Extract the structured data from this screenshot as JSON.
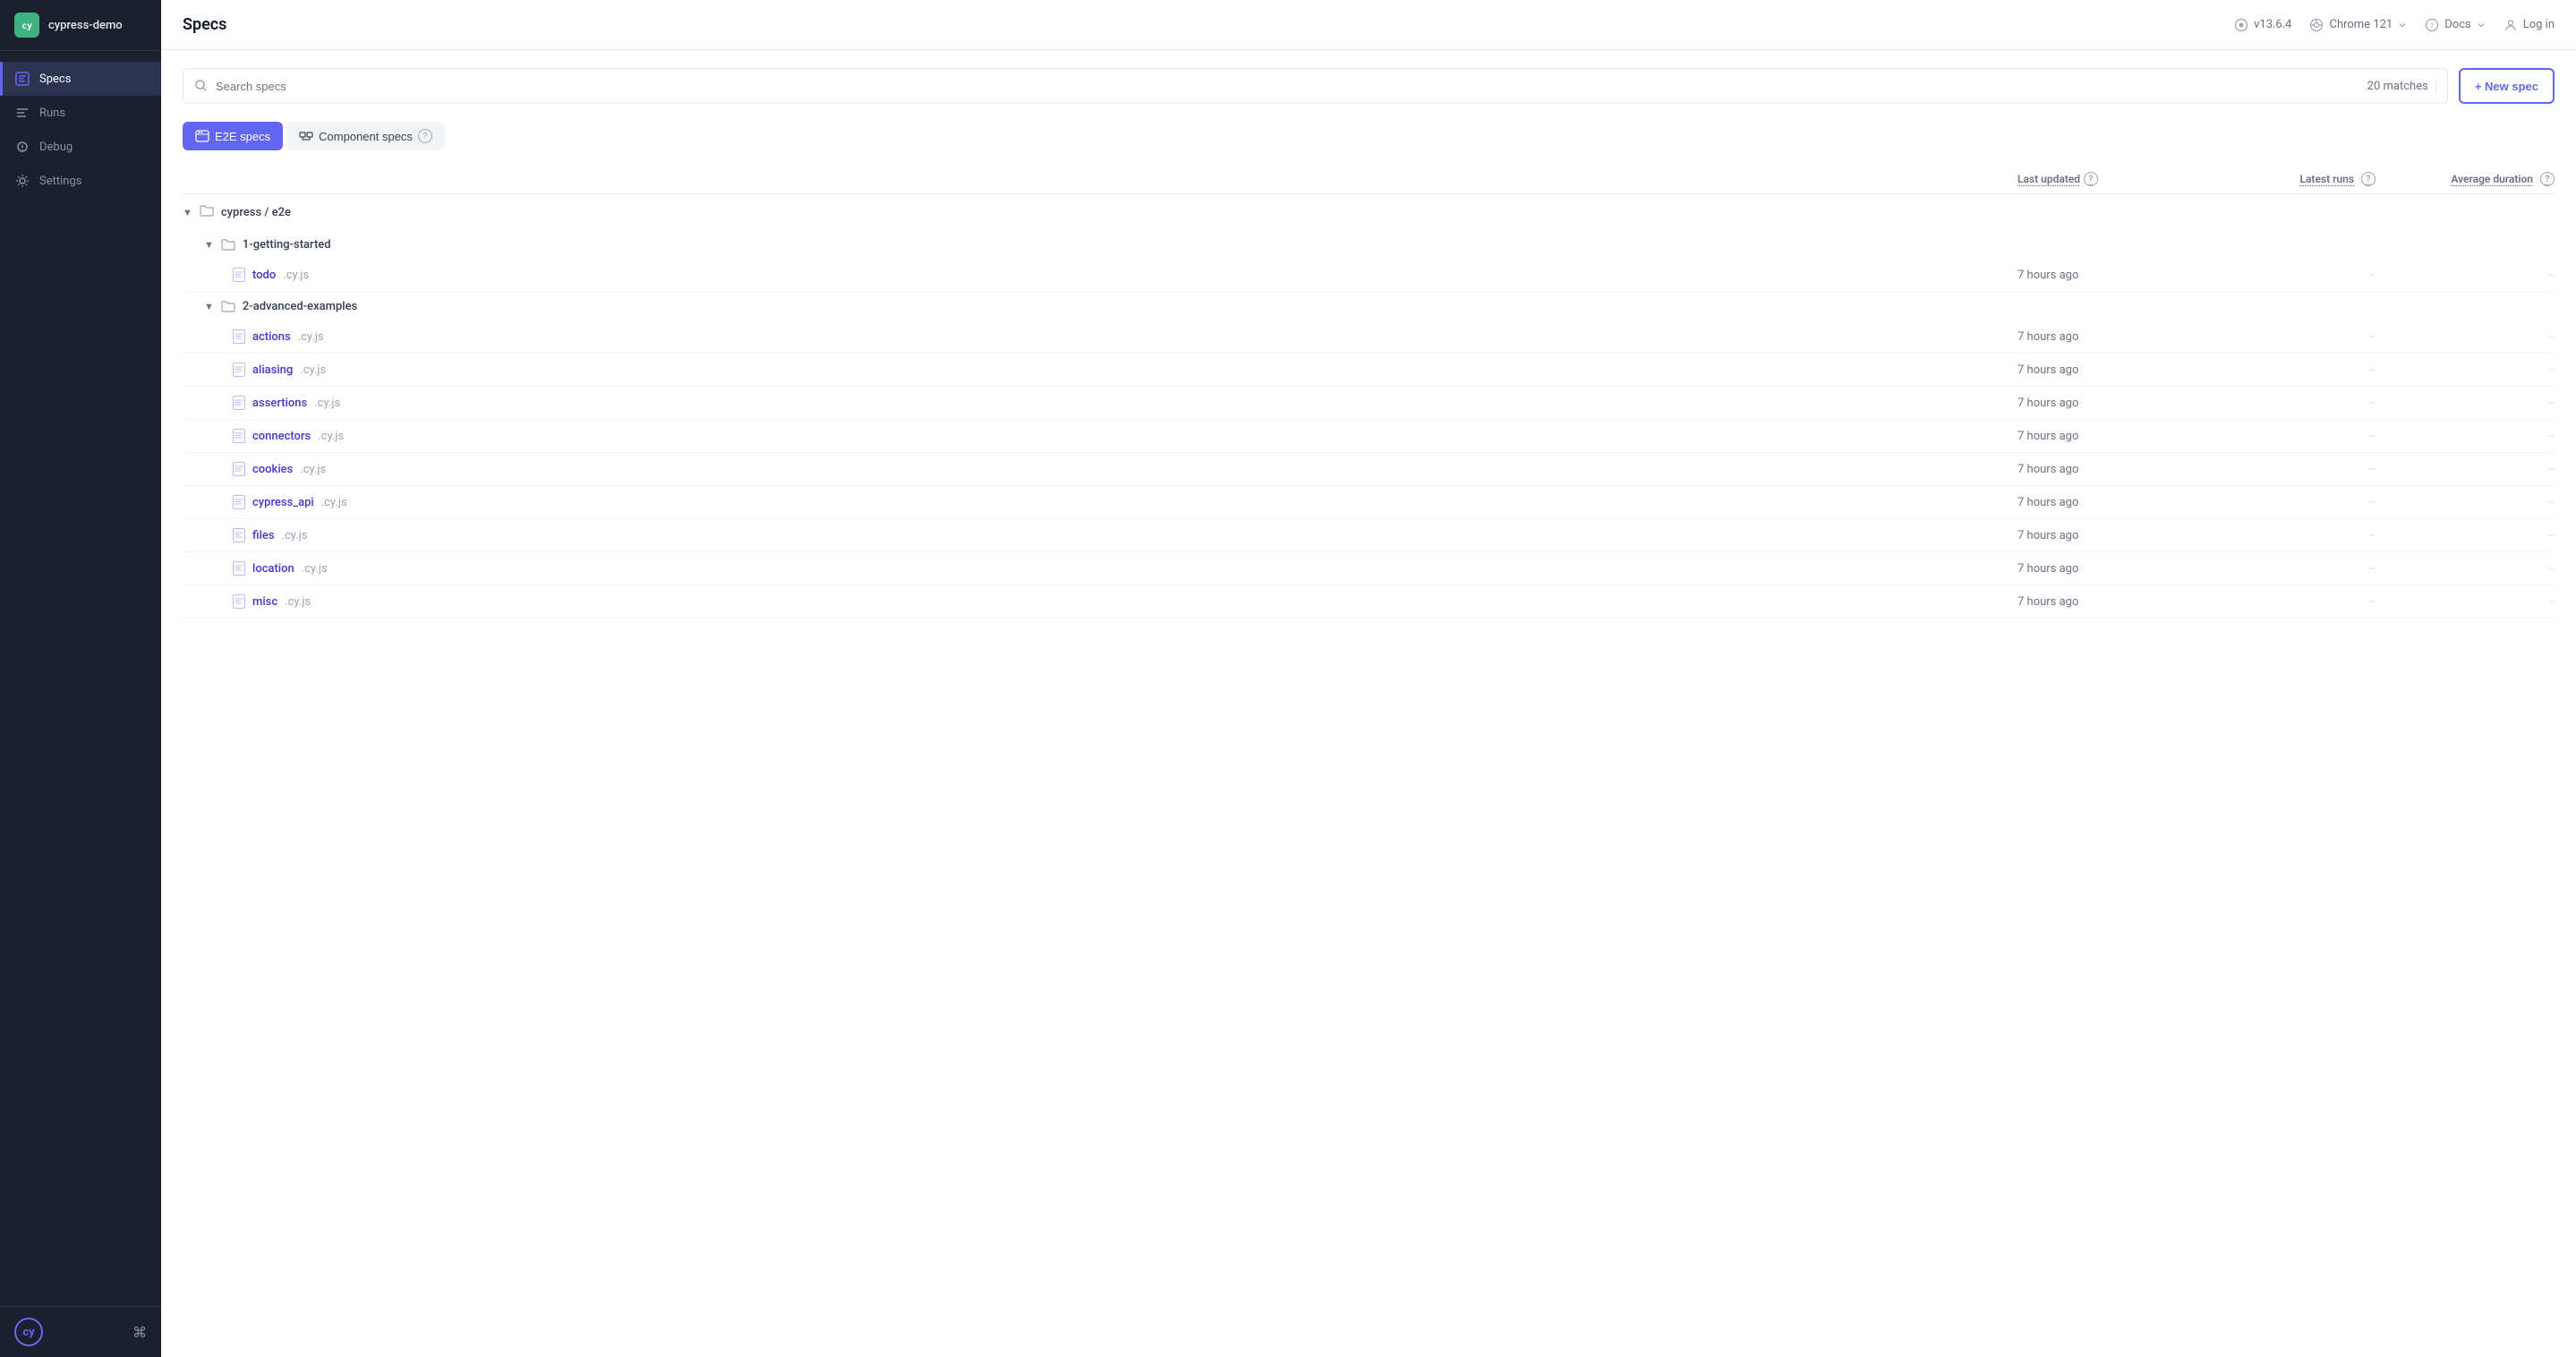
{
  "sidebar": {
    "app_name": "cypress-demo",
    "logo_text": "cy",
    "nav_items": [
      {
        "id": "specs",
        "label": "Specs",
        "active": true
      },
      {
        "id": "runs",
        "label": "Runs",
        "active": false
      },
      {
        "id": "debug",
        "label": "Debug",
        "active": false
      },
      {
        "id": "settings",
        "label": "Settings",
        "active": false
      }
    ],
    "cy_badge": "cy",
    "keyboard_shortcut": "⌘"
  },
  "header": {
    "title": "Specs",
    "version_label": "v13.6.4",
    "browser_label": "Chrome 121",
    "docs_label": "Docs",
    "login_label": "Log in"
  },
  "search": {
    "placeholder": "Search specs",
    "match_count": "20 matches"
  },
  "new_spec_button": "+ New spec",
  "tabs": [
    {
      "id": "e2e",
      "label": "E2E specs",
      "active": true
    },
    {
      "id": "component",
      "label": "Component specs",
      "active": false
    }
  ],
  "table_headers": {
    "spec": "",
    "last_updated": "Last updated",
    "latest_runs": "Latest runs",
    "average_duration": "Average duration"
  },
  "tree": {
    "root": "cypress / e2e",
    "folders": [
      {
        "name": "1-getting-started",
        "specs": [
          {
            "name": "todo",
            "ext": ".cy.js",
            "last_updated": "7 hours ago",
            "latest_runs": "--",
            "average_duration": "--"
          }
        ]
      },
      {
        "name": "2-advanced-examples",
        "specs": [
          {
            "name": "actions",
            "ext": ".cy.js",
            "last_updated": "7 hours ago",
            "latest_runs": "--",
            "average_duration": "--"
          },
          {
            "name": "aliasing",
            "ext": ".cy.js",
            "last_updated": "7 hours ago",
            "latest_runs": "--",
            "average_duration": "--"
          },
          {
            "name": "assertions",
            "ext": ".cy.js",
            "last_updated": "7 hours ago",
            "latest_runs": "--",
            "average_duration": "--"
          },
          {
            "name": "connectors",
            "ext": ".cy.js",
            "last_updated": "7 hours ago",
            "latest_runs": "--",
            "average_duration": "--"
          },
          {
            "name": "cookies",
            "ext": ".cy.js",
            "last_updated": "7 hours ago",
            "latest_runs": "--",
            "average_duration": "--"
          },
          {
            "name": "cypress_api",
            "ext": ".cy.js",
            "last_updated": "7 hours ago",
            "latest_runs": "--",
            "average_duration": "--"
          },
          {
            "name": "files",
            "ext": ".cy.js",
            "last_updated": "7 hours ago",
            "latest_runs": "--",
            "average_duration": "--"
          },
          {
            "name": "location",
            "ext": ".cy.js",
            "last_updated": "7 hours ago",
            "latest_runs": "--",
            "average_duration": "--"
          },
          {
            "name": "misc",
            "ext": ".cy.js",
            "last_updated": "7 hours ago",
            "latest_runs": "--",
            "average_duration": "--"
          }
        ]
      }
    ]
  }
}
